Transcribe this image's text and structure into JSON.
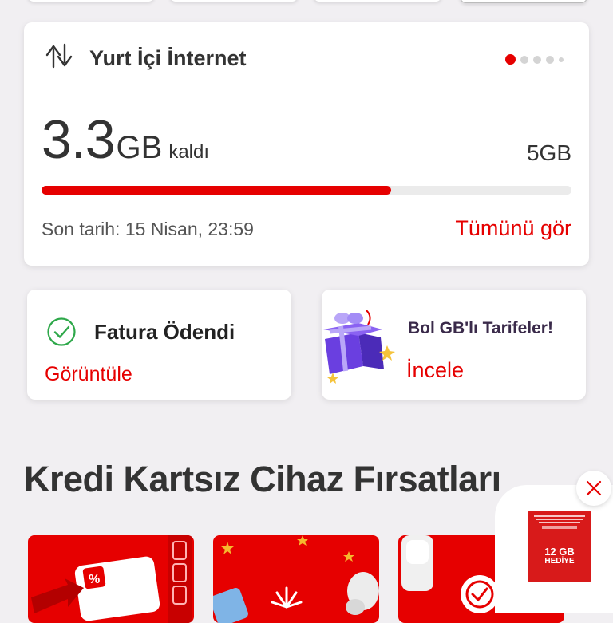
{
  "data_card": {
    "title": "Yurt İçi İnternet",
    "amount": "3.3",
    "unit": "GB",
    "remaining_label": "kaldı",
    "total": "5GB",
    "fraction_used": 0.66,
    "deadline": "Son tarih: 15 Nisan, 23:59",
    "see_all": "Tümünü gör",
    "page_dots": 5,
    "active_dot": 0
  },
  "bill_card": {
    "title": "Fatura Ödendi",
    "link": "Görüntüle"
  },
  "tariff_card": {
    "title": "Bol GB'lı Tarifeler!",
    "link": "İncele"
  },
  "section": {
    "title": "Kredi Kartsız Cihaz Fırsatları"
  },
  "floating_ad": {
    "close_icon": "close-icon",
    "line1": "12 GB",
    "line2": "HEDİYE"
  },
  "colors": {
    "accent": "#e60000",
    "background": "#f1eff2",
    "card": "#ffffff"
  }
}
